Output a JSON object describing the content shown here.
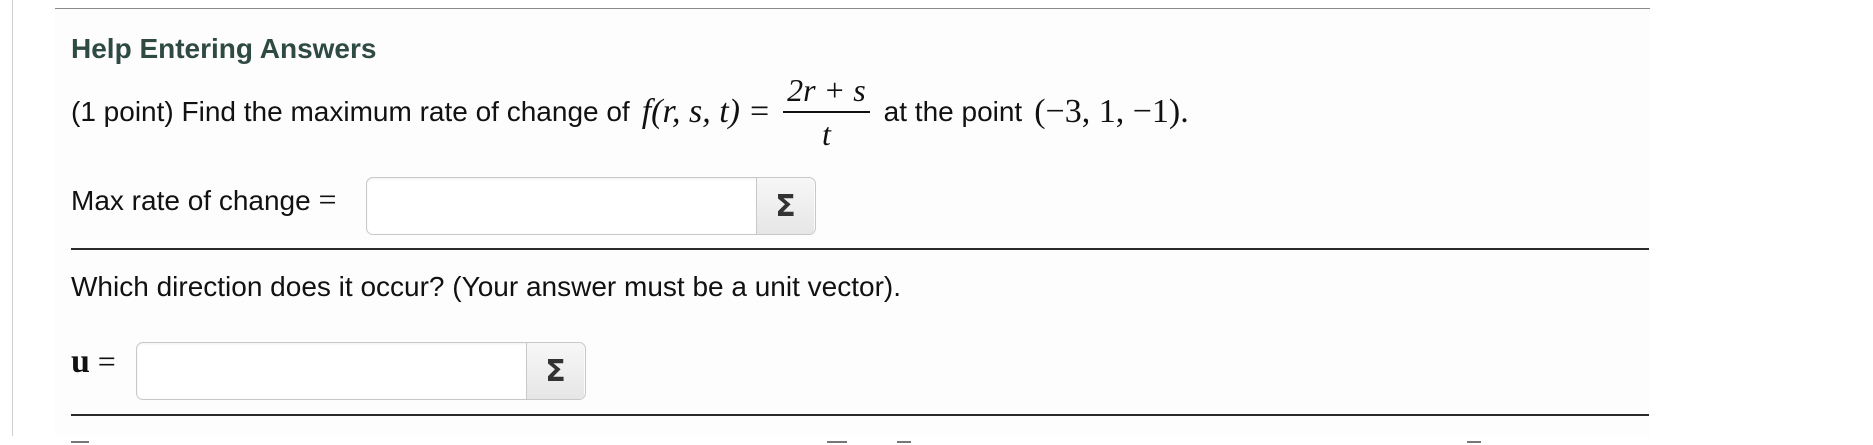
{
  "help": {
    "label": "Help Entering Answers"
  },
  "problem": {
    "prefix": "(1 point) Find the maximum rate of change of",
    "function_name": "f",
    "function_args": "(r, s, t)",
    "equals": "=",
    "numerator": "2r + s",
    "denominator": "t",
    "middle": "at the point",
    "point": "(−3, 1, −1)."
  },
  "max_rate": {
    "label": "Max rate of change",
    "equals": "=",
    "value": "",
    "sigma_symbol": "Σ"
  },
  "direction": {
    "question": "Which direction does it occur? (Your answer must be a unit vector)."
  },
  "unit_vector": {
    "symbol": "u",
    "equals": "=",
    "value": "",
    "sigma_symbol": "Σ"
  },
  "colors": {
    "help_link": "#2f4a43",
    "rule": "#2a2a2a"
  },
  "icons": {
    "equation_editor": "sigma-icon"
  }
}
